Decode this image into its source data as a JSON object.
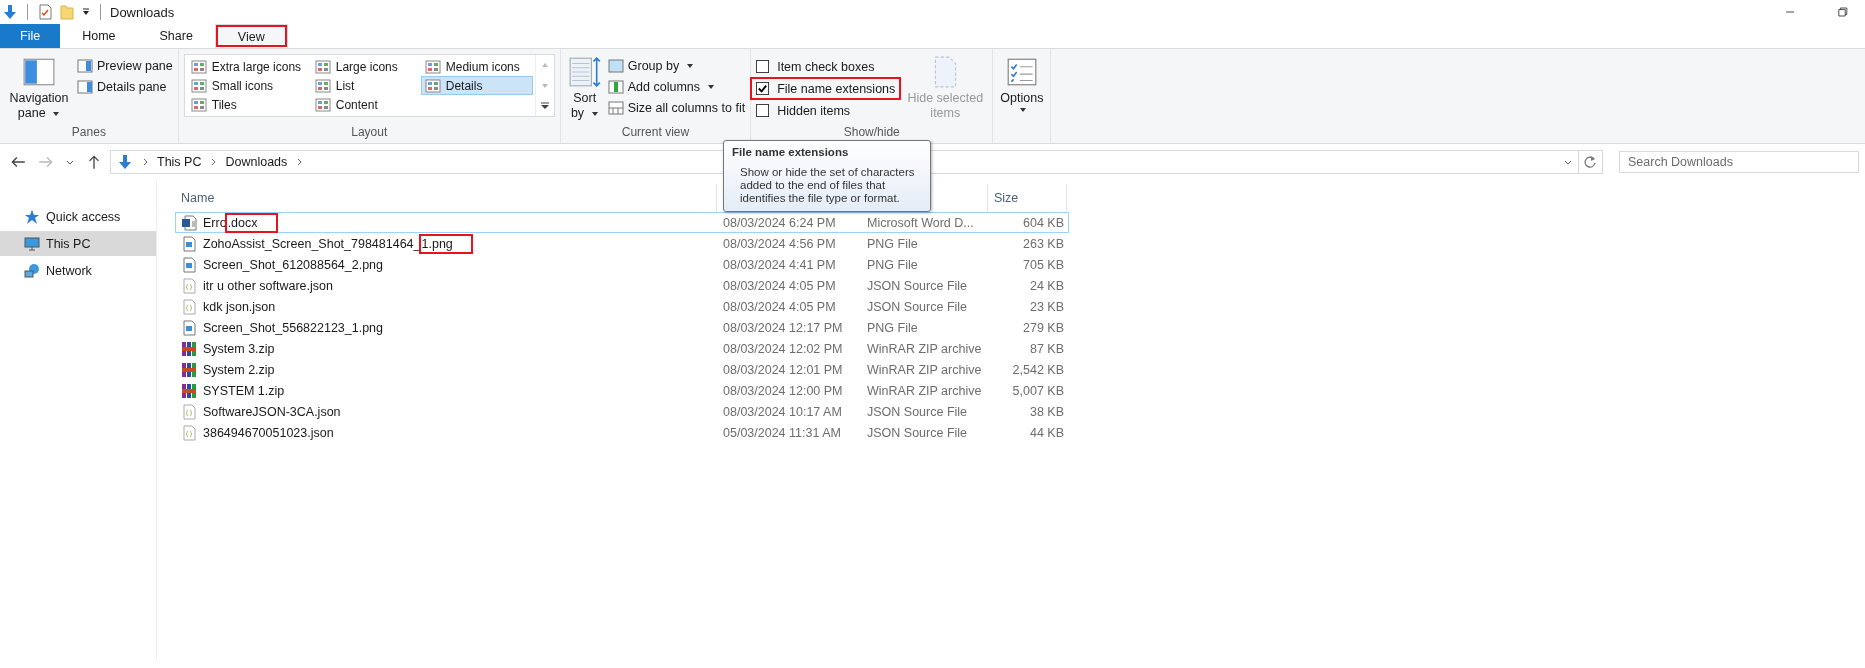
{
  "window": {
    "title": "Downloads"
  },
  "ribbon_tabs": [
    {
      "label": "File",
      "kind": "file",
      "selected": false,
      "annotated": false
    },
    {
      "label": "Home",
      "kind": "tab",
      "selected": false,
      "annotated": false
    },
    {
      "label": "Share",
      "kind": "tab",
      "selected": false,
      "annotated": false
    },
    {
      "label": "View",
      "kind": "tab",
      "selected": true,
      "annotated": true
    }
  ],
  "panes": {
    "navigation": "Navigation pane",
    "items": [
      "Preview pane",
      "Details pane"
    ],
    "label": "Panes"
  },
  "layout": {
    "items": [
      {
        "label": "Extra large icons",
        "selected": false
      },
      {
        "label": "Large icons",
        "selected": false
      },
      {
        "label": "Medium icons",
        "selected": false
      },
      {
        "label": "Small icons",
        "selected": false
      },
      {
        "label": "List",
        "selected": false
      },
      {
        "label": "Details",
        "selected": true
      },
      {
        "label": "Tiles",
        "selected": false
      },
      {
        "label": "Content",
        "selected": false
      }
    ],
    "label": "Layout"
  },
  "current_view": {
    "sort": "Sort by",
    "items": [
      {
        "label": "Group by",
        "dropdown": true
      },
      {
        "label": "Add columns",
        "dropdown": true
      },
      {
        "label": "Size all columns to fit",
        "dropdown": false
      }
    ],
    "label": "Current view"
  },
  "show_hide": {
    "checkboxes": [
      {
        "label": "Item check boxes",
        "checked": false,
        "annotated": false
      },
      {
        "label": "File name extensions",
        "checked": true,
        "annotated": true
      },
      {
        "label": "Hidden items",
        "checked": false,
        "annotated": false
      }
    ],
    "hide_selected": {
      "label": "Hide selected items",
      "disabled": true
    },
    "label": "Show/hide"
  },
  "options": {
    "label": "Options"
  },
  "address": {
    "crumbs": [
      "This PC",
      "Downloads"
    ]
  },
  "search": {
    "placeholder": "Search Downloads"
  },
  "sidebar": {
    "items": [
      {
        "label": "Quick access",
        "kind": "star",
        "selected": false
      },
      {
        "label": "This PC",
        "kind": "pc",
        "selected": true
      },
      {
        "label": "Network",
        "kind": "network",
        "selected": false
      }
    ]
  },
  "table": {
    "columns": [
      {
        "label": "Name"
      },
      {
        "label": "Size"
      }
    ],
    "rows": [
      {
        "name": "Erro",
        "marked": ".docx",
        "date": "08/03/2024 6:24 PM",
        "type": "Microsoft Word D...",
        "size": "604 KB",
        "kind": "word",
        "focused": true
      },
      {
        "name": "ZohoAssist_Screen_Shot_798481464_",
        "marked": "1.png",
        "date": "08/03/2024 4:56 PM",
        "type": "PNG File",
        "size": "263 KB",
        "kind": "png",
        "focused": false
      },
      {
        "name": "Screen_Shot_612088564_2.png",
        "date": "08/03/2024 4:41 PM",
        "type": "PNG File",
        "size": "705 KB",
        "kind": "png",
        "focused": false
      },
      {
        "name": "itr u other software.json",
        "date": "08/03/2024 4:05 PM",
        "type": "JSON Source File",
        "size": "24 KB",
        "kind": "json",
        "focused": false
      },
      {
        "name": "kdk json.json",
        "date": "08/03/2024 4:05 PM",
        "type": "JSON Source File",
        "size": "23 KB",
        "kind": "json",
        "focused": false
      },
      {
        "name": "Screen_Shot_556822123_1.png",
        "date": "08/03/2024 12:17 PM",
        "type": "PNG File",
        "size": "279 KB",
        "kind": "png",
        "focused": false
      },
      {
        "name": "System 3.zip",
        "date": "08/03/2024 12:02 PM",
        "type": "WinRAR ZIP archive",
        "size": "87 KB",
        "kind": "zip",
        "focused": false
      },
      {
        "name": "System 2.zip",
        "date": "08/03/2024 12:01 PM",
        "type": "WinRAR ZIP archive",
        "size": "2,542 KB",
        "kind": "zip",
        "focused": false
      },
      {
        "name": "SYSTEM 1.zip",
        "date": "08/03/2024 12:00 PM",
        "type": "WinRAR ZIP archive",
        "size": "5,007 KB",
        "kind": "zip",
        "focused": false
      },
      {
        "name": "SoftwareJSON-3CA.json",
        "date": "08/03/2024 10:17 AM",
        "type": "JSON Source File",
        "size": "38 KB",
        "kind": "json",
        "focused": false
      },
      {
        "name": "386494670051023.json",
        "date": "05/03/2024 11:31 AM",
        "type": "JSON Source File",
        "size": "44 KB",
        "kind": "json",
        "focused": false
      }
    ]
  },
  "tooltip": {
    "title": "File name extensions",
    "body": "Show or hide the set of characters added to the end of files that identifies the file type or format."
  }
}
